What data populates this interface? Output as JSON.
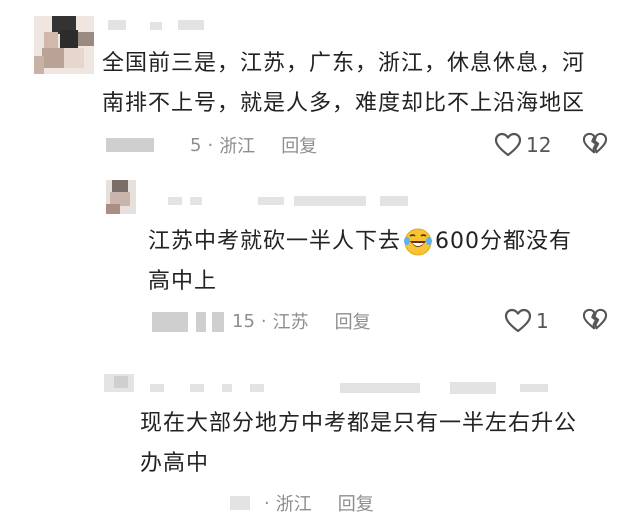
{
  "comments": [
    {
      "text_line1": "全国前三是，江苏，广东，浙江，休息休息，河",
      "text_line2": "南排不上号，就是人多，难度却比不上沿海地区",
      "date": "5",
      "location": "浙江",
      "reply_label": "回复",
      "likes": "12"
    },
    {
      "text_line1": "江苏中考就砍一半人下去",
      "text_line1b": "600分都没有",
      "text_line2": "高中上",
      "date": "15",
      "location": "江苏",
      "reply_label": "回复",
      "likes": "1"
    },
    {
      "text_line1": "现在大部分地方中考都是只有一半左右升公",
      "text_line2": "办高中",
      "date": "",
      "location": "浙江",
      "reply_label": "回复"
    }
  ],
  "icons": {
    "like": "heart-outline-icon",
    "dislike": "broken-heart-icon",
    "emoji": "rolling-laughing-emoji"
  },
  "colors": {
    "text": "#222222",
    "meta": "#8e8e8e",
    "icon": "#555555"
  }
}
